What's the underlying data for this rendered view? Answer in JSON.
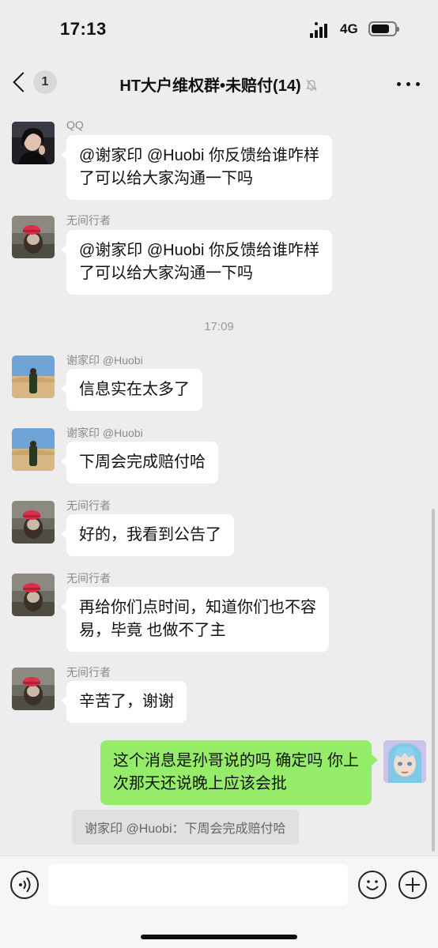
{
  "status_bar": {
    "time": "17:13",
    "network": "4G"
  },
  "header": {
    "back_badge": "1",
    "title": "HT大户维权群•未赔付(14)",
    "icons": [
      "back-chevron-icon",
      "mute-bell-icon",
      "more-dots-icon"
    ]
  },
  "messages": [
    {
      "sender": "QQ",
      "lines": [
        "@谢家印 @Huobi 你反馈给谁咋样",
        "了可以给大家沟通一下吗"
      ],
      "avatar": "woman-portrait"
    },
    {
      "sender": "无间行者",
      "lines": [
        "@谢家印 @Huobi 你反馈给谁咋样",
        "了可以给大家沟通一下吗"
      ],
      "avatar": "dog-red-hat"
    },
    {
      "sender": "谢家印 @Huobi",
      "lines": [
        "信息实在太多了"
      ],
      "avatar": "desert-man"
    },
    {
      "sender": "谢家印 @Huobi",
      "lines": [
        "下周会完成赔付哈"
      ],
      "avatar": "desert-man"
    },
    {
      "sender": "无间行者",
      "lines": [
        "好的，我看到公告了"
      ],
      "avatar": "dog-red-hat"
    },
    {
      "sender": "无间行者",
      "lines": [
        "再给你们点时间，知道你们也不容",
        "易，毕竟 也做不了主"
      ],
      "avatar": "dog-red-hat"
    },
    {
      "sender": "无间行者",
      "lines": [
        "辛苦了，谢谢"
      ],
      "avatar": "dog-red-hat"
    }
  ],
  "timestamp": "17:09",
  "self_message": {
    "lines": [
      "这个消息是孙哥说的吗 确定吗 你上",
      "次那天还说晚上应该会批"
    ],
    "quote": "谢家印 @Huobi：下周会完成赔付哈",
    "avatar": "anime-blue-hair"
  },
  "input_bar": {
    "placeholder": "",
    "icons": [
      "voice-icon",
      "emoji-icon",
      "plus-icon"
    ]
  },
  "colors": {
    "background": "#ededed",
    "self_bubble": "#95ec69",
    "other_bubble": "#ffffff"
  }
}
